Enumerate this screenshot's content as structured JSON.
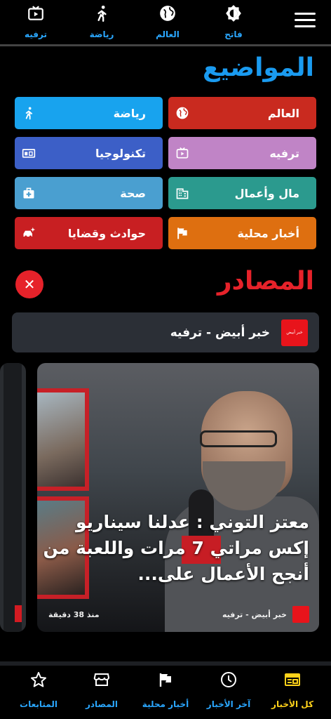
{
  "top_nav": {
    "items": [
      {
        "label": "ترفيه",
        "icon": "tv-play-icon"
      },
      {
        "label": "رياضة",
        "icon": "running-person-icon"
      },
      {
        "label": "العالم",
        "icon": "globe-icon"
      },
      {
        "label": "فاتح",
        "icon": "brightness-icon"
      }
    ],
    "menu_icon": "hamburger-menu-icon"
  },
  "topics": {
    "title": "المواضيع",
    "items": [
      {
        "label": "العالم",
        "icon": "globe-icon",
        "color": "#c92a1f"
      },
      {
        "label": "رياضة",
        "icon": "running-person-icon",
        "color": "#18a3ee"
      },
      {
        "label": "ترفيه",
        "icon": "tv-play-icon",
        "color": "#c084c6"
      },
      {
        "label": "تكنولوجيا",
        "icon": "devices-icon",
        "color": "#3c5fc7"
      },
      {
        "label": "مال وأعمال",
        "icon": "building-icon",
        "color": "#2b9a8e"
      },
      {
        "label": "صحة",
        "icon": "medical-kit-icon",
        "color": "#4a9fd0"
      },
      {
        "label": "أخبار محلية",
        "icon": "flag-icon",
        "color": "#de6f10"
      },
      {
        "label": "حوادث وقضايا",
        "icon": "car-crash-icon",
        "color": "#c81f22"
      }
    ]
  },
  "sources": {
    "title": "المصادر",
    "close_icon": "close-icon",
    "source_name": "خبر أبيض - ترفيه",
    "source_logo_text": "خبر أبيض"
  },
  "article": {
    "headline": "معتز التوني : عدلنا سيناريو إكس مراتي 7 مرات واللعبة من أنجح الأعمال على...",
    "source": "خبر أبيض - ترفيه",
    "time": "منذ 38 دقيقة"
  },
  "bottom_nav": {
    "items": [
      {
        "label": "كل الأخبار",
        "icon": "newspaper-icon",
        "active": true
      },
      {
        "label": "آخر الأخبار",
        "icon": "clock-icon",
        "active": false
      },
      {
        "label": "أخبار محلية",
        "icon": "flag-icon",
        "active": false
      },
      {
        "label": "المصادر",
        "icon": "storefront-icon",
        "active": false
      },
      {
        "label": "المتابعات",
        "icon": "star-icon",
        "active": false
      }
    ]
  },
  "colors": {
    "accent_blue": "#2aa7ff",
    "accent_red": "#e6222a",
    "active_yellow": "#ffd21a"
  }
}
